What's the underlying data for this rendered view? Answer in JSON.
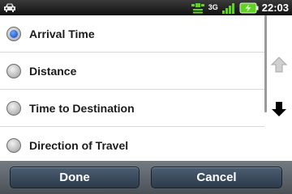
{
  "status_bar": {
    "network": "3G",
    "time": "22:03",
    "icons": [
      "car-icon",
      "gps-icon",
      "signal-icon",
      "battery-icon"
    ]
  },
  "options": [
    {
      "label": "Arrival Time",
      "selected": true
    },
    {
      "label": "Distance",
      "selected": false
    },
    {
      "label": "Time to Destination",
      "selected": false
    },
    {
      "label": "Direction of Travel",
      "selected": false
    }
  ],
  "scroll": {
    "up_icon": "arrow-up-icon",
    "down_icon": "arrow-down-icon"
  },
  "buttons": {
    "done_label": "Done",
    "cancel_label": "Cancel"
  },
  "colors": {
    "accent": "#0a3fb5",
    "button": "#3a4d61",
    "battery": "#5fd41e"
  }
}
